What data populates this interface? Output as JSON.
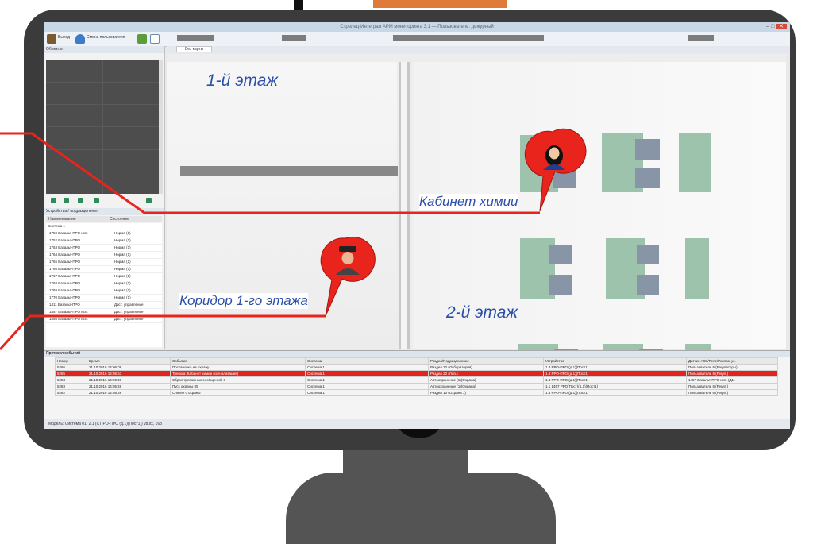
{
  "window": {
    "title": "Стрелец-Интеграл АРМ мониторинга 3.1 — Пользователь: дежурный",
    "controls": [
      "–",
      "□",
      "✕"
    ]
  },
  "toolbar": {
    "exit_label": "Выход",
    "user_label": "Смена пользователя"
  },
  "left_panel": {
    "video_title": "Объекты",
    "devices_title": "Устройства / подразделения",
    "col_name": "Наименование",
    "col_state": "Состояние",
    "tree_root": "Система 1",
    "devices": [
      {
        "name": "1750 Базальт-ПРО исп.",
        "state": "Норма (1)"
      },
      {
        "name": "1752 Базальт-ПРО",
        "state": "Норма (1)"
      },
      {
        "name": "1763 Базальт-ПРО",
        "state": "Норма (1)"
      },
      {
        "name": "1764 Базальт-ПРО",
        "state": "Норма (1)"
      },
      {
        "name": "1765 Базальт-ПРО",
        "state": "Норма (1)"
      },
      {
        "name": "1766 Базальт-ПРО",
        "state": "Норма (1)"
      },
      {
        "name": "1767 Базальт-ПРО",
        "state": "Норма (1)"
      },
      {
        "name": "1768 Базальт-ПРО",
        "state": "Норма (1)"
      },
      {
        "name": "1769 Базальт-ПРО",
        "state": "Норма (1)"
      },
      {
        "name": "1770 Базальт-ПРО",
        "state": "Норма (1)"
      },
      {
        "name": "1411 Базальт-ПРО",
        "state": "Дист. управление"
      },
      {
        "name": "1457 Базальт-ПРО исп.",
        "state": "Дист. управление"
      },
      {
        "name": "1856 Базальт-ПРО исп.",
        "state": "Дист. управление"
      }
    ]
  },
  "map": {
    "tab_label": "Без карты",
    "floor1_label": "1-й этаж",
    "floor2_label": "2-й этаж",
    "chemistry_label": "Кабинет химии",
    "corridor_label": "Коридор 1-го этажа"
  },
  "events": {
    "title": "Протокол событий",
    "columns": [
      "Номер",
      "Время",
      "Событие",
      "Система",
      "Раздел/Подразделение",
      "Устройство",
      "Датчик АКС/Реле/Реклам ус."
    ],
    "rows": [
      {
        "n": "5286",
        "time": "21.10.2016 14:06:08",
        "event": "Постановка на охрану",
        "sys": "Система 1",
        "zone": "Раздел 22 (Лаборатория)",
        "dev": "1.3 РРО-ПРО (д.1)(Пост1)",
        "sensor": "Пользователь 6 (Регуляторы)",
        "alarm": false
      },
      {
        "n": "5285",
        "time": "21.10.2016 14:05:53",
        "event": "Тревога: Кабинет химии (сигнализация)",
        "sys": "Система 1",
        "zone": "Раздел 22 (Лаб.)",
        "dev": "1.3 РРО-ПРО (д.1)(Пост1)",
        "sensor": "Пользователь 6 (Регул.)",
        "alarm": true
      },
      {
        "n": "5284",
        "time": "21.10.2016 14:05:46",
        "event": "Сброс тревожных сообщений: 3",
        "sys": "Система 1",
        "zone": "Автоохранение (1)(Охрана)",
        "dev": "1.3 РРО-ПРО (д.1)(Пост1)",
        "sensor": "1457 Базальт-ПРО исп. (Д1)",
        "alarm": false
      },
      {
        "n": "5283",
        "time": "21.10.2016 14:05:46",
        "event": "Пуск охраны 05",
        "sys": "Система 1",
        "zone": "Автоохранение (1)(Охрана)",
        "dev": "1.1 1457 РРО(Пост)(д.1)(Пост1)",
        "sensor": "Пользователь 6 (Регул.)",
        "alarm": false
      },
      {
        "n": "5282",
        "time": "21.10.2016 14:05:46",
        "event": "Снятие с охраны",
        "sys": "Система 1",
        "zone": "Раздел 10 (Охрана 1)",
        "dev": "1.3 РРО-ПРО (д.1)(Пост1)",
        "sensor": "Пользователь 6 (Регул.)",
        "alarm": false
      }
    ]
  },
  "statusbar": {
    "text": "Модель: Система 01, 2.1 (СТ РО-ПРО (д.1)(Пост1)) v8.xx, 168"
  },
  "colors": {
    "alarm": "#e0241e",
    "pin": "#e8241c",
    "map_label": "#2b4fa8",
    "bezel": "#3b3b3b"
  },
  "icons": [
    "user-female-icon",
    "guard-icon",
    "exit-icon",
    "change-user-icon"
  ]
}
